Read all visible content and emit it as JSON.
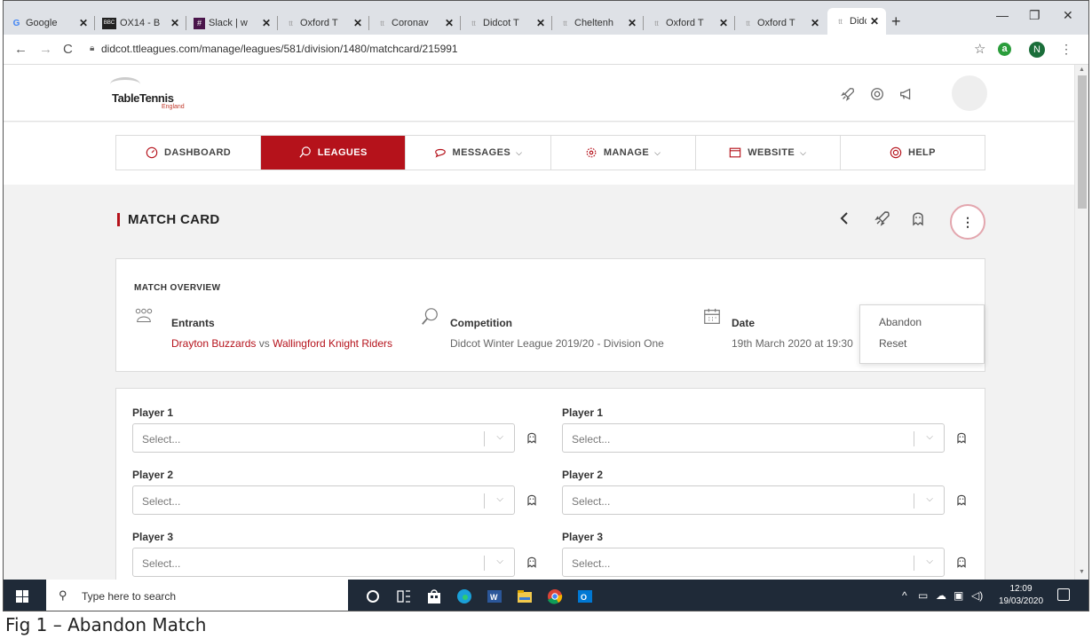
{
  "browser": {
    "tabs": [
      {
        "icon": "google-icon",
        "label": "Google",
        "active": false
      },
      {
        "icon": "bbc-icon",
        "label": "OX14 - B",
        "active": false
      },
      {
        "icon": "slack-icon",
        "label": "Slack | w",
        "active": false
      },
      {
        "icon": "tt-icon",
        "label": "Oxford T",
        "active": false
      },
      {
        "icon": "tt-icon",
        "label": "Coronav",
        "active": false
      },
      {
        "icon": "tt-icon",
        "label": "Didcot T",
        "active": false
      },
      {
        "icon": "tt-icon",
        "label": "Cheltenh",
        "active": false
      },
      {
        "icon": "tt-icon",
        "label": "Oxford T",
        "active": false
      },
      {
        "icon": "tt-icon",
        "label": "Oxford T",
        "active": false
      },
      {
        "icon": "tt-icon",
        "label": "Didcot T",
        "active": true
      }
    ],
    "new_tab": "+",
    "url": "didcot.ttleagues.com/manage/leagues/581/division/1480/matchcard/215991",
    "profile_initial": "N",
    "extension_initial": "a"
  },
  "site": {
    "logo_text": "TableTennis",
    "logo_sub": "England",
    "nav": [
      {
        "label": "DASHBOARD",
        "icon": "dashboard-icon",
        "active": false,
        "chevron": ""
      },
      {
        "label": "LEAGUES",
        "icon": "leagues-icon",
        "active": true,
        "chevron": ""
      },
      {
        "label": "MESSAGES",
        "icon": "messages-icon",
        "active": false,
        "chevron": "⌵"
      },
      {
        "label": "MANAGE",
        "icon": "gear-icon",
        "active": false,
        "chevron": "⌵"
      },
      {
        "label": "WEBSITE",
        "icon": "website-icon",
        "active": false,
        "chevron": "⌵"
      },
      {
        "label": "HELP",
        "icon": "help-icon",
        "active": false,
        "chevron": ""
      }
    ]
  },
  "page": {
    "title": "MATCH CARD",
    "more_label": "⋮",
    "menu": [
      "Abandon",
      "Reset"
    ],
    "overview": {
      "label": "MATCH OVERVIEW",
      "entrants_label": "Entrants",
      "home_team": "Drayton Buzzards",
      "vs": "vs",
      "away_team": "Wallingford Knight Riders",
      "competition_label": "Competition",
      "competition": "Didcot Winter League 2019/20 - Division One",
      "date_label": "Date",
      "date": "19th March 2020 at 19:30"
    },
    "players": {
      "home": [
        {
          "label": "Player 1",
          "placeholder": "Select..."
        },
        {
          "label": "Player 2",
          "placeholder": "Select..."
        },
        {
          "label": "Player 3",
          "placeholder": "Select..."
        }
      ],
      "away": [
        {
          "label": "Player 1",
          "placeholder": "Select..."
        },
        {
          "label": "Player 2",
          "placeholder": "Select..."
        },
        {
          "label": "Player 3",
          "placeholder": "Select..."
        }
      ]
    }
  },
  "taskbar": {
    "search_placeholder": "Type here to search",
    "time": "12:09",
    "date": "19/03/2020"
  },
  "caption": "Fig 1 – Abandon Match",
  "colors": {
    "brand_red": "#b5121b",
    "taskbar": "#1f2a38"
  }
}
